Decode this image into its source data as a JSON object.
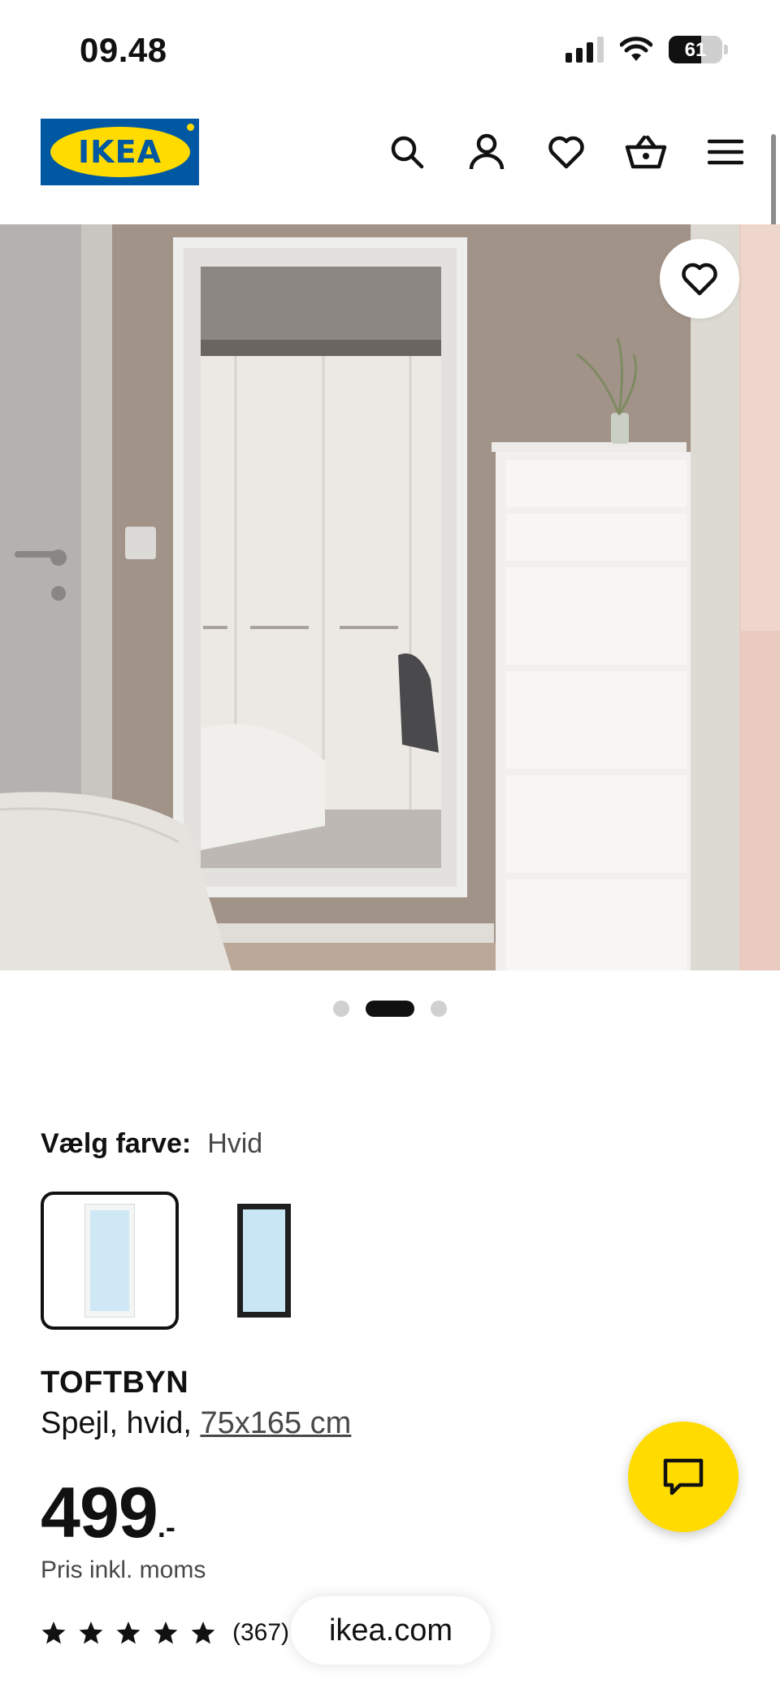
{
  "status_bar": {
    "time": "09.48",
    "battery": "61",
    "battery_level": 0.61
  },
  "header": {
    "logo_text": "IKEA",
    "icons": [
      "search-icon",
      "account-icon",
      "favorites-icon",
      "cart-icon",
      "menu-icon"
    ]
  },
  "gallery": {
    "total_images": 3,
    "active_index": 1
  },
  "color_select": {
    "label": "Vælg farve:",
    "value": "Hvid",
    "options": [
      "white",
      "black"
    ],
    "selected_index": 0
  },
  "product": {
    "name": "TOFTBYN",
    "desc_prefix": "Spejl, hvid,",
    "size_link": "75x165 cm",
    "price_int": "499",
    "price_suffix": ".-",
    "price_note": "Pris inkl. moms",
    "rating_stars": 5,
    "rating_count": "(367)"
  },
  "browser": {
    "url": "ikea.com"
  },
  "colors": {
    "brand_blue": "#0058a3",
    "brand_yellow": "#ffdb00"
  }
}
